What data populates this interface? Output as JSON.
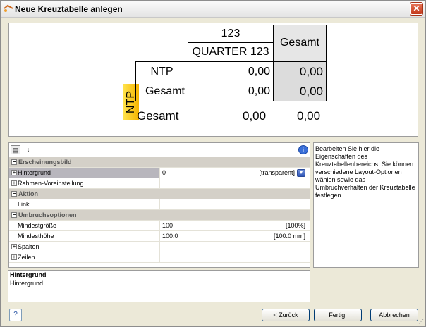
{
  "window": {
    "title": "Neue Kreuztabelle anlegen",
    "close_label": "✕"
  },
  "crosstab": {
    "col_header_top": "123",
    "col_header_sub": "QUARTER 123",
    "total_col_header": "Gesamt",
    "row_dimension": "NTP",
    "rows": [
      {
        "label": "NTP",
        "value": "0,00",
        "total": "0,00"
      },
      {
        "label": "Gesamt",
        "value": "0,00",
        "total": "0,00"
      }
    ],
    "footer": {
      "label": "Gesamt",
      "value": "0,00",
      "total": "0,00"
    }
  },
  "properties": {
    "toolbar": {
      "categorized_icon": "categorized-icon",
      "sort_icon": "sort-az-icon",
      "info_icon": "info-icon"
    },
    "rows": [
      {
        "type": "category",
        "label": "Erscheinungsbild"
      },
      {
        "type": "prop",
        "label": "Hintergrund",
        "value": "0",
        "value_right": "[transparent]",
        "expand": true,
        "selected": true,
        "dropdown": true
      },
      {
        "type": "prop",
        "label": "Rahmen-Voreinstellung",
        "value": "",
        "value_right": "",
        "expand": true
      },
      {
        "type": "category",
        "label": "Aktion"
      },
      {
        "type": "prop",
        "label": "Link",
        "value": "",
        "value_right": ""
      },
      {
        "type": "category",
        "label": "Umbruchsoptionen"
      },
      {
        "type": "prop",
        "label": "Mindestgröße",
        "value": "100",
        "value_right": "[100%]"
      },
      {
        "type": "prop",
        "label": "Mindesthöhe",
        "value": "100.0",
        "value_right": "[100.0 mm]"
      },
      {
        "type": "prop",
        "label": "Spalten",
        "value": "",
        "value_right": "",
        "expand": true
      },
      {
        "type": "prop",
        "label": "Zeilen",
        "value": "",
        "value_right": "",
        "expand": true
      }
    ]
  },
  "help_text": "Bearbeiten Sie hier die Eigenschaften des Kreuztabellenbereichs. Sie können verschiedene Layout-Optionen wählen sowie das Umbruchverhalten der Kreuztabelle festlegen.",
  "description": {
    "title": "Hintergrund",
    "text": "Hintergrund."
  },
  "buttons": {
    "help": "?",
    "back": "< Zurück",
    "finish": "Fertig!",
    "cancel": "Abbrechen"
  }
}
